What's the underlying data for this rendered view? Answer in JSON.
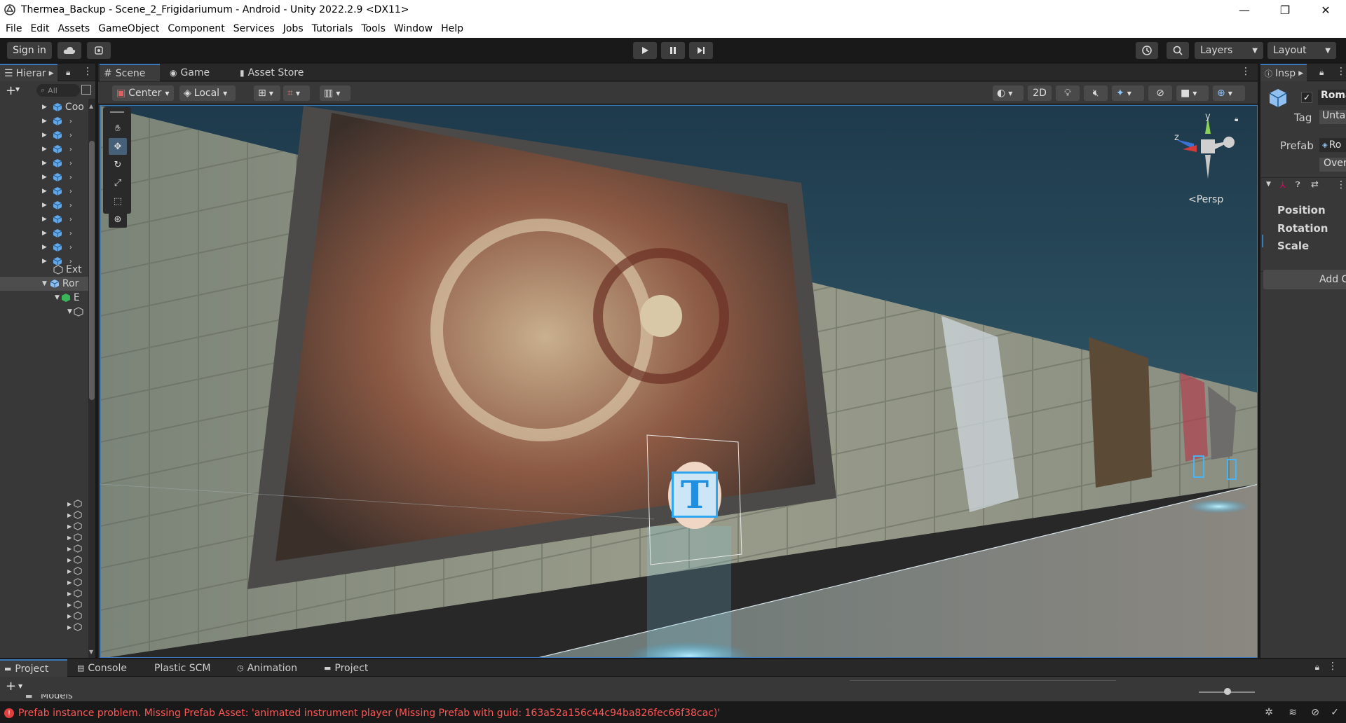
{
  "window": {
    "title": "Thermea_Backup - Scene_2_Frigidariumum - Android - Unity 2022.2.9 <DX11>",
    "minimize": "—",
    "restore": "❐",
    "close": "✕"
  },
  "menu": [
    "File",
    "Edit",
    "Assets",
    "GameObject",
    "Component",
    "Services",
    "Jobs",
    "Tutorials",
    "Tools",
    "Window",
    "Help"
  ],
  "toolbar": {
    "sign_in": "Sign in",
    "layers": "Layers",
    "layout": "Layout"
  },
  "hierarchy": {
    "tab": "Hierar",
    "search_placeholder": "All",
    "items": [
      "Coo",
      "Ext",
      "Ror",
      "E"
    ]
  },
  "center_tabs": {
    "scene": "Scene",
    "game": "Game",
    "asset_store": "Asset Store"
  },
  "scene_toolbar": {
    "pivot": "Center",
    "space": "Local",
    "mode_2d": "2D"
  },
  "viewport": {
    "projection": "<Persp",
    "gizmo_y": "y",
    "gizmo_z": "z",
    "text_icon": "T"
  },
  "inspector": {
    "tab": "Insp",
    "object_name": "Roma",
    "tag_label": "Tag",
    "tag_value": "Unta",
    "prefab_label": "Prefab",
    "prefab_value": "Ro",
    "overrides": "Over",
    "position": "Position",
    "rotation": "Rotation",
    "scale": "Scale",
    "add_component": "Add C"
  },
  "bottom_tabs": {
    "project": "Project",
    "console": "Console",
    "plastic": "Plastic SCM",
    "animation": "Animation",
    "project2": "Project",
    "folder": "Models"
  },
  "status": {
    "error": "Prefab instance problem. Missing Prefab Asset: 'animated instrument player (Missing Prefab with guid: 163a52a156c44c94ba826fec66f38cac)'"
  }
}
